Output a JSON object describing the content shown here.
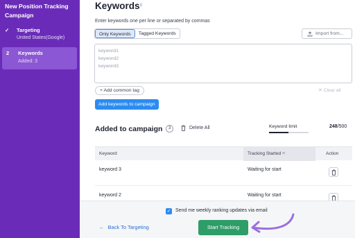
{
  "sidebar": {
    "title": "New Position Tracking Campaign",
    "steps": [
      {
        "mark": "✓",
        "label": "Targeting",
        "sub": "United States(Google)"
      },
      {
        "mark": "2",
        "label": "Keywords",
        "sub": "Added: 3"
      }
    ]
  },
  "main": {
    "title": "Keywords",
    "title_sup": "£",
    "instructions": "Enter keywords one per line or separated by commas",
    "tabs": [
      {
        "label": "Only Keywords"
      },
      {
        "label": "Tagged Keywords"
      }
    ],
    "import_label": "Import from...",
    "placeholder_lines": [
      "keyword1",
      "keyword2",
      "keyword3"
    ],
    "add_tag_label": "+ Add common tag",
    "clear_all_label": "Clear all",
    "add_keywords_label": "Add keywords to campaign",
    "added_title": "Added to campaign",
    "added_count": "3",
    "delete_all_label": "Delete All",
    "limit_label": "Keyword limit",
    "limit_used": "248",
    "limit_total": "/500",
    "limit_fraction": 0.496,
    "table": {
      "columns": [
        "Keyword",
        "Tracking Started",
        "Action"
      ],
      "rows": [
        {
          "keyword": "keyword 3",
          "status": "Waiting for start"
        },
        {
          "keyword": "keyword 2",
          "status": "Waiting for start"
        }
      ]
    }
  },
  "footer": {
    "email_label": "Send me weekly ranking updates via email",
    "back_label": "Back To Targeting",
    "start_label": "Start Tracking"
  },
  "colors": {
    "sidebar_bg": "#6a2cb8",
    "active_step_bg": "#8b57d4",
    "primary_blue": "#2b8cf0",
    "start_green": "#2e9d68",
    "annotation_arrow": "#9b6fe0"
  },
  "icons": [
    "check-icon",
    "upload-icon",
    "close-icon",
    "trash-icon",
    "sort-icon",
    "arrow-left-icon"
  ]
}
